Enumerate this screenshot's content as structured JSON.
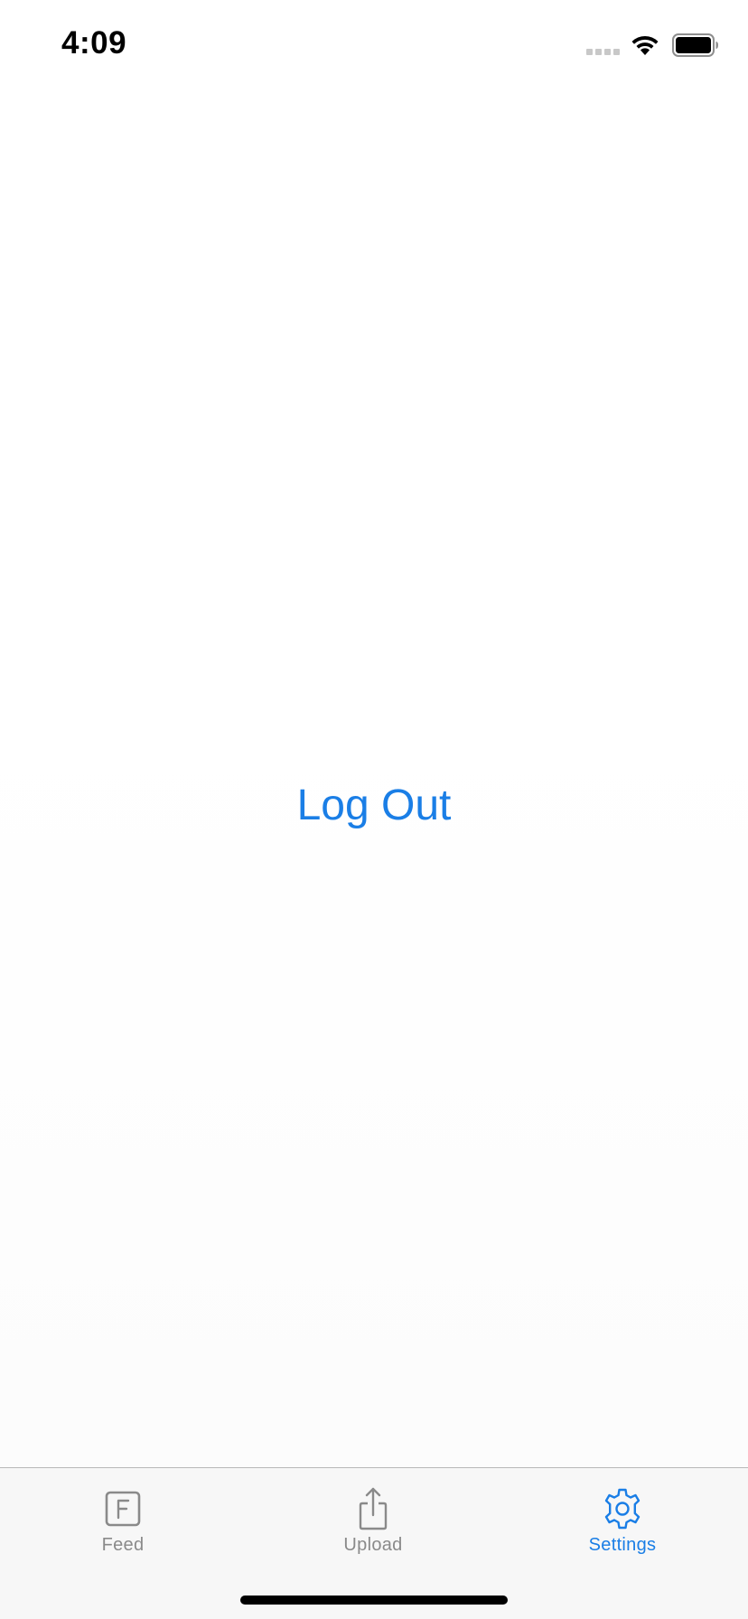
{
  "status_bar": {
    "time": "4:09"
  },
  "main": {
    "logout_label": "Log Out"
  },
  "tab_bar": {
    "tabs": [
      {
        "label": "Feed",
        "icon": "feed-letter-f-icon",
        "active": false
      },
      {
        "label": "Upload",
        "icon": "share-upload-icon",
        "active": false
      },
      {
        "label": "Settings",
        "icon": "gear-icon",
        "active": true
      }
    ]
  },
  "colors": {
    "accent": "#1a7ee6",
    "inactive": "#8a8a8a",
    "tab_bar_background": "#f7f7f7"
  }
}
